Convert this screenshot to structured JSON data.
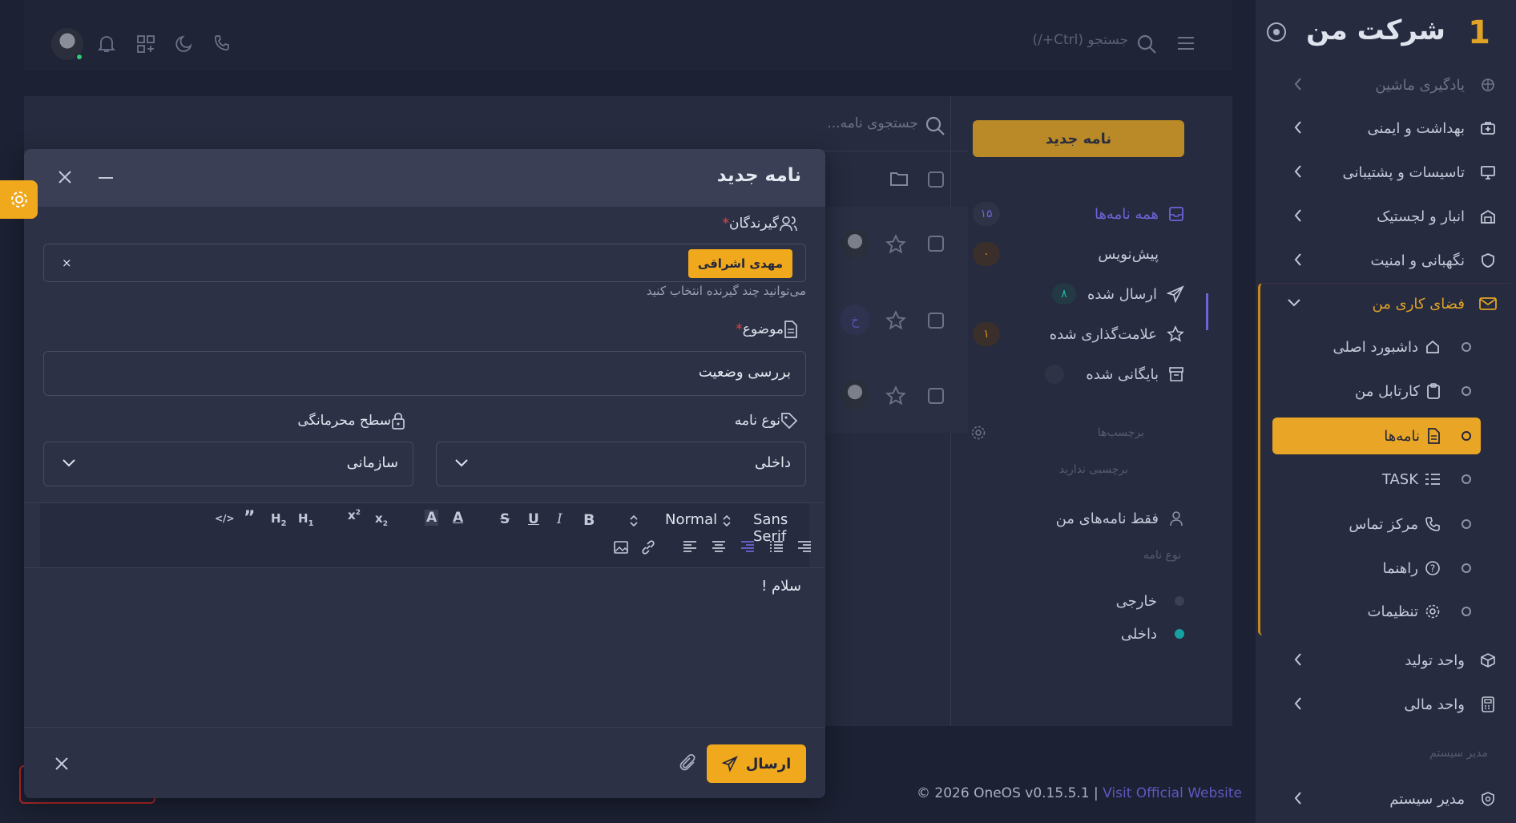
{
  "sidebar": {
    "brand_number": "1",
    "brand_name": "شرکت من",
    "items": [
      {
        "label": "یادگیری ماشین",
        "icon": "brain-icon"
      },
      {
        "label": "بهداشت و ایمنی",
        "icon": "first-aid-icon"
      },
      {
        "label": "تاسیسات و پشتیبانی",
        "icon": "monitor-icon"
      },
      {
        "label": "انبار و لجستیک",
        "icon": "warehouse-icon"
      },
      {
        "label": "نگهبانی و امنیت",
        "icon": "shield-icon"
      }
    ],
    "workspace": {
      "label": "فضای کاری من",
      "icon": "mail-icon",
      "sub_items": [
        {
          "label": "داشبورد اصلی",
          "icon": "home-icon"
        },
        {
          "label": "کارتابل من",
          "icon": "clipboard-icon"
        },
        {
          "label": "نامه‌ها",
          "icon": "document-icon"
        },
        {
          "label": "TASK",
          "icon": "list-icon"
        },
        {
          "label": "مرکز تماس",
          "icon": "phone-icon"
        },
        {
          "label": "راهنما",
          "icon": "help-icon"
        },
        {
          "label": "تنظیمات",
          "icon": "settings-icon"
        }
      ]
    },
    "bottom_items": [
      {
        "label": "واحد تولید",
        "icon": "cube-icon"
      },
      {
        "label": "واحد مالی",
        "icon": "calculator-icon"
      }
    ],
    "section_label": "مدیر سیستم",
    "admin_item": {
      "label": "مدیر سیستم",
      "icon": "shield-gear-icon"
    }
  },
  "topbar": {
    "search_placeholder": "جستجو (Ctrl+/)"
  },
  "mailnav": {
    "new_letter": "نامه جدید",
    "folders": [
      {
        "label": "همه نامه‌ها",
        "badge": "۱۵"
      },
      {
        "label": "پیش‌نویس",
        "badge": "۰"
      },
      {
        "label": "ارسال شده",
        "badge": "۸"
      },
      {
        "label": "علامت‌گذاری شده",
        "badge": "۱"
      },
      {
        "label": "بایگانی شده",
        "badge": ""
      }
    ],
    "labels_title": "برچسب‌ها",
    "no_labels": "برچسبی ندارید",
    "only_mine": "فقط نامه‌های من",
    "type_title": "نوع نامه",
    "types": [
      {
        "label": "خارجی",
        "color": "#3b4055"
      },
      {
        "label": "داخلی",
        "color": "#17a2a2"
      }
    ]
  },
  "maillist": {
    "search_placeholder": "جستجوی نامه...",
    "row_letter": "خ"
  },
  "footer": {
    "copyright": "© 2026 OneOS v0.15.5.1 | ",
    "link": "Visit Official Website"
  },
  "modal": {
    "title": "نامه جدید",
    "recipients_label": "گیرندگان",
    "recipient_chip": "مهدی اشراقی",
    "recipients_hint": "می‌توانید چند گیرنده انتخاب کنید",
    "subject_label": "موضوع",
    "subject_value": "بررسی وضعیت",
    "type_label": "نوع نامه",
    "type_value": "داخلی",
    "privacy_label": "سطح محرمانگی",
    "privacy_value": "سازمانی",
    "font_family": "Sans Serif",
    "font_size": "Normal",
    "body_text": "سلام !",
    "send_label": "ارسال"
  }
}
